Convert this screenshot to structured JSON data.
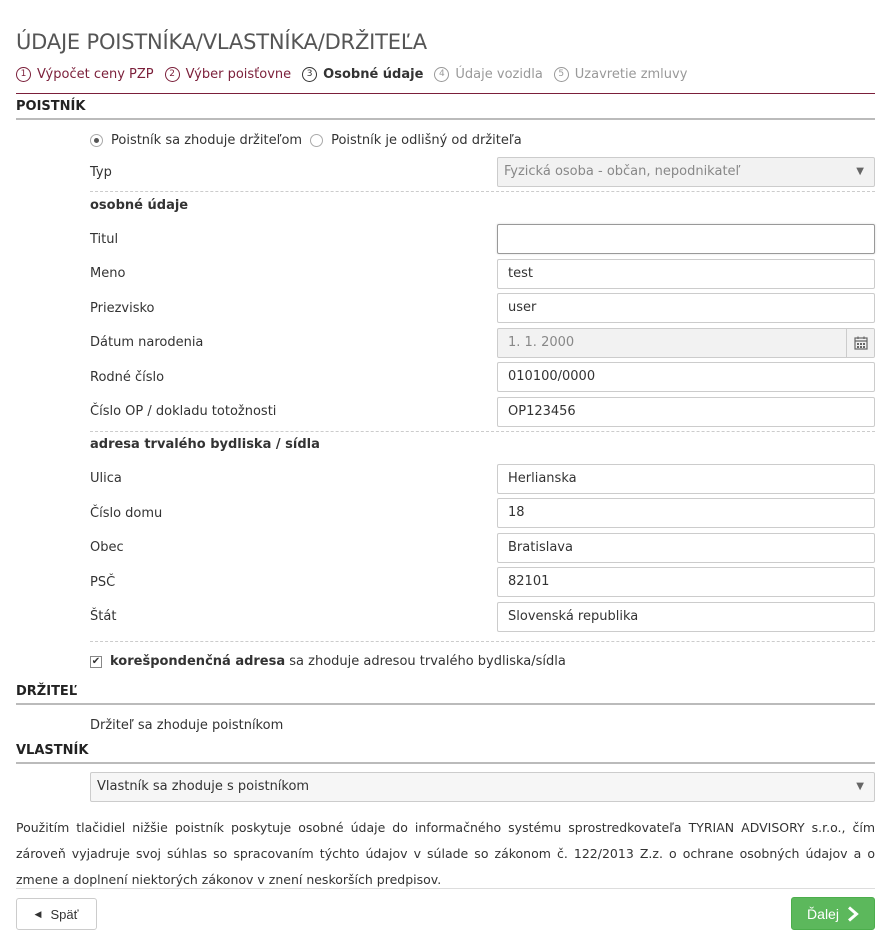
{
  "page": {
    "title": "ÚDAJE POISTNÍKA/VLASTNÍKA/DRŽITEĽA"
  },
  "steps": [
    {
      "num": "1",
      "label": "Výpočet ceny PZP",
      "state": "done"
    },
    {
      "num": "2",
      "label": "Výber poisťovne",
      "state": "done"
    },
    {
      "num": "3",
      "label": "Osobné údaje",
      "state": "active"
    },
    {
      "num": "4",
      "label": "Údaje vozidla",
      "state": "future"
    },
    {
      "num": "5",
      "label": "Uzavretie zmluvy",
      "state": "future"
    }
  ],
  "poistnik": {
    "heading": "POISTNÍK",
    "radio_same": "Poistník sa zhoduje držiteľom",
    "radio_diff": "Poistník je odlišný od držiteľa",
    "typ_label": "Typ",
    "typ_value": "Fyzická osoba - občan, nepodnikateľ",
    "personal_heading": "osobné údaje",
    "titul_label": "Titul",
    "titul_value": "",
    "meno_label": "Meno",
    "meno_value": "test",
    "priezvisko_label": "Priezvisko",
    "priezvisko_value": "user",
    "datum_label": "Dátum narodenia",
    "datum_value": "1. 1. 2000",
    "rodne_label": "Rodné číslo",
    "rodne_value": "010100/0000",
    "op_label": "Číslo OP / dokladu totožnosti",
    "op_value": "OP123456",
    "address_heading": "adresa trvalého bydliska / sídla",
    "ulica_label": "Ulica",
    "ulica_value": "Herlianska",
    "cislo_label": "Číslo domu",
    "cislo_value": "18",
    "obec_label": "Obec",
    "obec_value": "Bratislava",
    "psc_label": "PSČ",
    "psc_value": "82101",
    "stat_label": "Štát",
    "stat_value": "Slovenská republika",
    "koresp_bold": "korešpondenčná adresa",
    "koresp_rest": " sa zhoduje adresou trvalého bydliska/sídla",
    "koresp_checked": true
  },
  "drzitel": {
    "heading": "DRŽITEĽ",
    "text": "Držiteľ sa zhoduje poistníkom"
  },
  "vlastnik": {
    "heading": "VLASTNÍK",
    "select_value": "Vlastník sa zhoduje s poistníkom"
  },
  "consent_text": "Použitím tlačidiel nižšie poistník poskytuje osobné údaje do informačného systému sprostredkovateľa TYRIAN ADVISORY s.r.o., čím zároveň vyjadruje svoj súhlas so spracovaním týchto údajov v súlade so zákonom č. 122/2013 Z.z. o ochrane osobných údajov a o zmene a doplnení niektorých zákonov v znení neskorších predpisov.",
  "buttons": {
    "back": "Späť",
    "next": "Ďalej"
  },
  "colors": {
    "accent": "#7b1f3a",
    "success": "#5cb85c"
  }
}
